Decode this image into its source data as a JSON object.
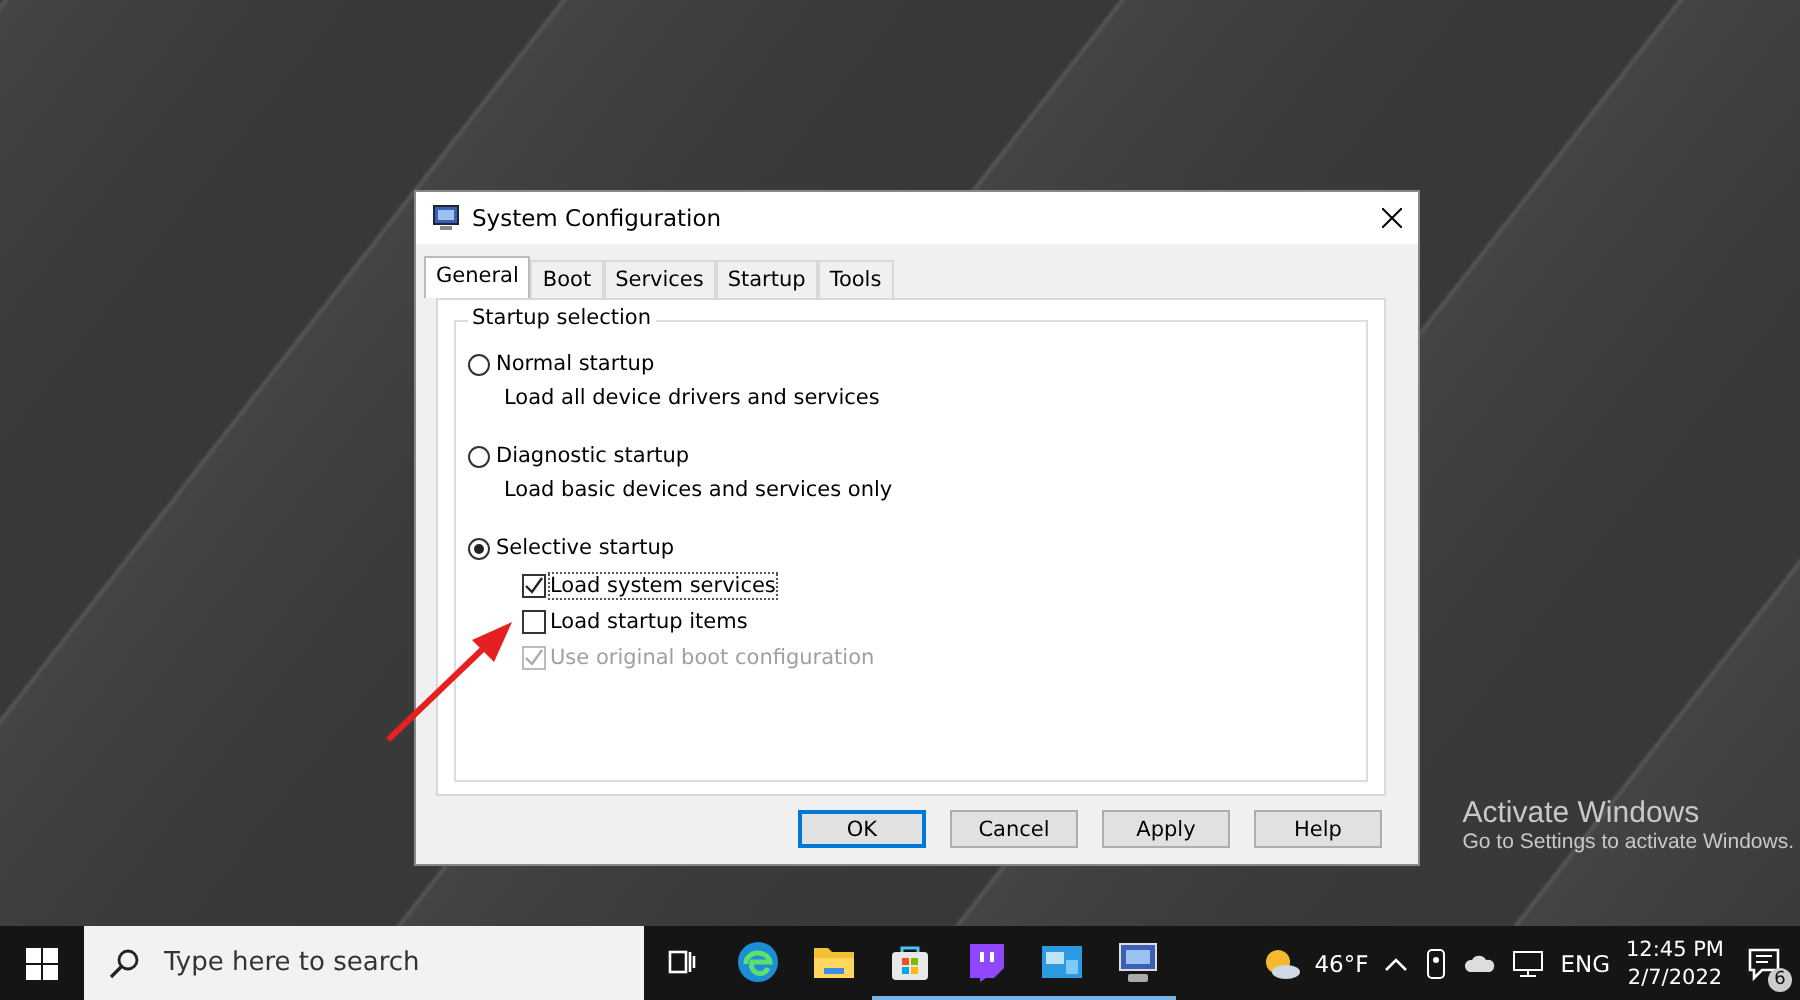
{
  "window": {
    "title": "System Configuration"
  },
  "tabs": [
    {
      "label": "General",
      "selected": true
    },
    {
      "label": "Boot",
      "selected": false
    },
    {
      "label": "Services",
      "selected": false
    },
    {
      "label": "Startup",
      "selected": false
    },
    {
      "label": "Tools",
      "selected": false
    }
  ],
  "group": {
    "title": "Startup selection"
  },
  "options": [
    {
      "label": "Normal startup",
      "description": "Load all device drivers and services",
      "selected": false
    },
    {
      "label": "Diagnostic startup",
      "description": "Load basic devices and services only",
      "selected": false
    },
    {
      "label": "Selective startup",
      "selected": true,
      "children": [
        {
          "label": "Load system services",
          "checked": true,
          "disabled": false,
          "focused": true
        },
        {
          "label": "Load startup items",
          "checked": false,
          "disabled": false,
          "focused": false
        },
        {
          "label": "Use original boot configuration",
          "checked": true,
          "disabled": true,
          "focused": false
        }
      ]
    }
  ],
  "buttons": [
    {
      "label": "OK",
      "default": true
    },
    {
      "label": "Cancel",
      "default": false
    },
    {
      "label": "Apply",
      "default": false
    },
    {
      "label": "Help",
      "default": false
    }
  ],
  "activation": {
    "title": "Activate Windows",
    "subtitle": "Go to Settings to activate Windows."
  },
  "taskbar": {
    "search": {
      "placeholder": "Type here to search"
    },
    "apps": [
      {
        "kind": "taskview",
        "running": false
      },
      {
        "kind": "browser",
        "running": false
      },
      {
        "kind": "folder",
        "running": false
      },
      {
        "kind": "store",
        "running": true
      },
      {
        "kind": "chat",
        "running": true
      },
      {
        "kind": "panel",
        "running": true
      },
      {
        "kind": "monitor",
        "running": true
      }
    ],
    "weather": "46°F",
    "language": "ENG",
    "time": "12:45 PM",
    "date": "2/7/2022",
    "notifications": "6"
  }
}
